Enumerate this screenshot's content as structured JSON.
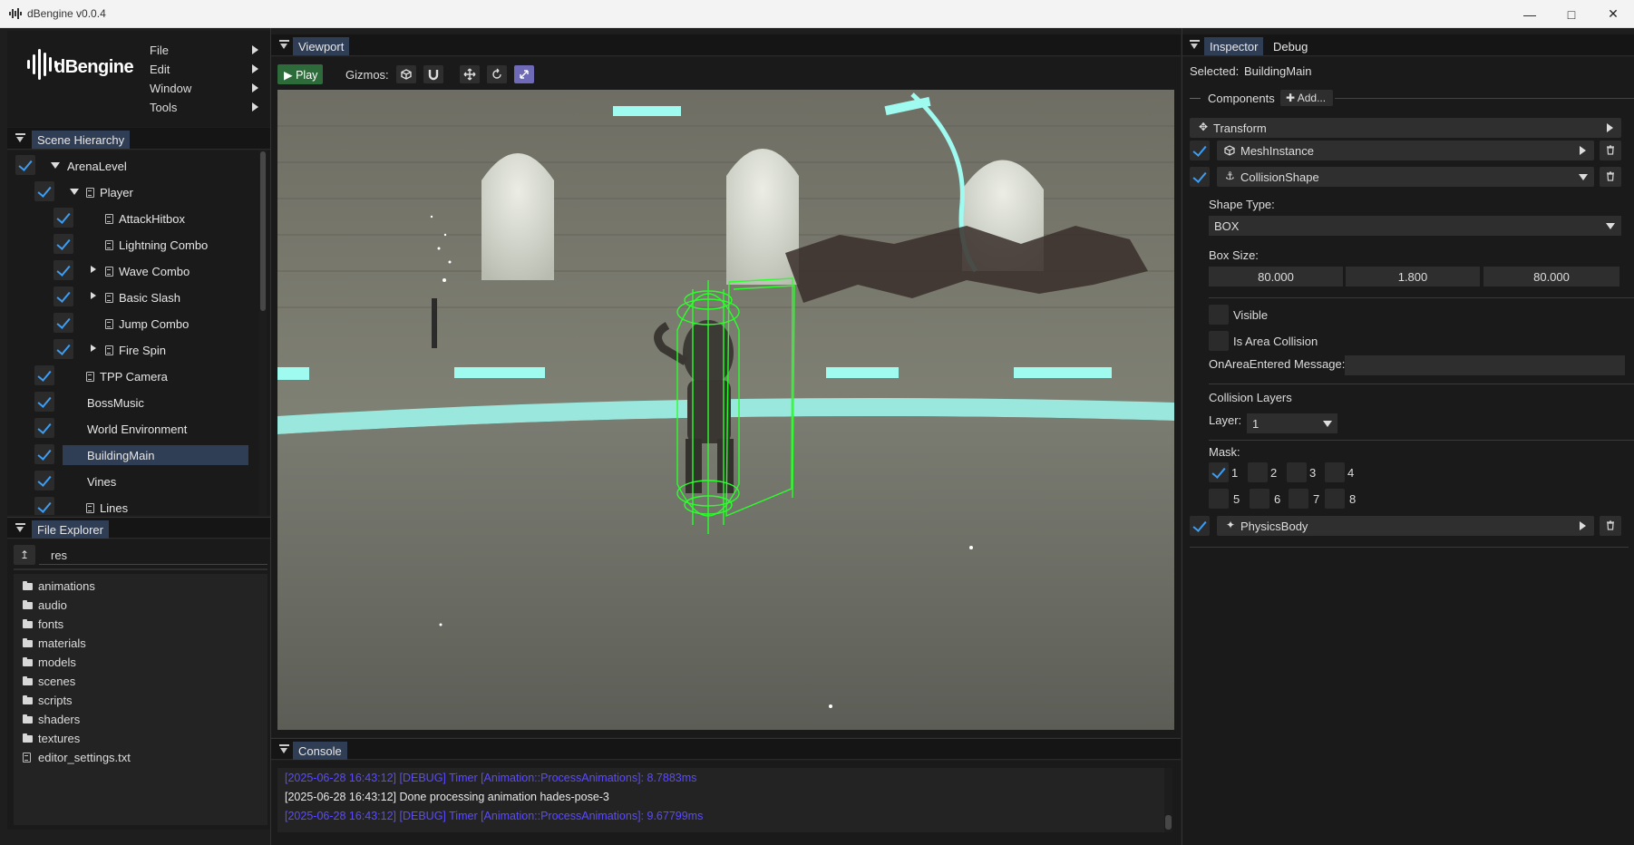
{
  "window": {
    "title": "dBengine v0.0.4"
  },
  "brand": {
    "logo_text": "dBengine"
  },
  "menu": [
    {
      "label": "File"
    },
    {
      "label": "Edit"
    },
    {
      "label": "Window"
    },
    {
      "label": "Tools"
    }
  ],
  "scene_hierarchy": {
    "tab": "Scene Hierarchy",
    "nodes": [
      {
        "label": "ArenaLevel",
        "checked": true,
        "selected": false
      },
      {
        "label": "Player",
        "checked": true
      },
      {
        "label": "AttackHitbox",
        "checked": true
      },
      {
        "label": "Lightning Combo",
        "checked": true
      },
      {
        "label": "Wave Combo",
        "checked": true
      },
      {
        "label": "Basic Slash",
        "checked": true
      },
      {
        "label": "Jump Combo",
        "checked": true
      },
      {
        "label": "Fire Spin",
        "checked": true
      },
      {
        "label": "TPP Camera",
        "checked": true
      },
      {
        "label": "BossMusic",
        "checked": true
      },
      {
        "label": "World Environment",
        "checked": true
      },
      {
        "label": "BuildingMain",
        "checked": true,
        "selected": true
      },
      {
        "label": "Vines",
        "checked": true
      },
      {
        "label": "Lines",
        "checked": true
      }
    ]
  },
  "file_explorer": {
    "tab": "File Explorer",
    "path": "res",
    "items": [
      {
        "label": "animations",
        "type": "folder"
      },
      {
        "label": "audio",
        "type": "folder"
      },
      {
        "label": "fonts",
        "type": "folder"
      },
      {
        "label": "materials",
        "type": "folder"
      },
      {
        "label": "models",
        "type": "folder"
      },
      {
        "label": "scenes",
        "type": "folder"
      },
      {
        "label": "scripts",
        "type": "folder"
      },
      {
        "label": "shaders",
        "type": "folder"
      },
      {
        "label": "textures",
        "type": "folder"
      },
      {
        "label": "editor_settings.txt",
        "type": "file"
      }
    ]
  },
  "viewport": {
    "tab": "Viewport",
    "play_label": "▶ Play",
    "gizmos_label": "Gizmos:"
  },
  "console": {
    "tab": "Console",
    "lines": [
      {
        "text": "[2025-06-28 16:43:12] [DEBUG] Timer [Animation::ProcessAnimations]: 8.7883ms",
        "color": "#5b4bff"
      },
      {
        "text": "[2025-06-28 16:43:12] Done processing animation hades-pose-3",
        "color": "#e8e8e8"
      },
      {
        "text": "[2025-06-28 16:43:12] [DEBUG] Timer [Animation::ProcessAnimations]: 9.67799ms",
        "color": "#5b4bff"
      }
    ]
  },
  "inspector": {
    "tabs": [
      "Inspector",
      "Debug"
    ],
    "selected_label": "Selected:",
    "selected_value": "BuildingMain",
    "components_label": "Components",
    "add_label": "✚ Add...",
    "transform": "Transform",
    "mesh_instance": "MeshInstance",
    "collision_shape": "CollisionShape",
    "shape_type_label": "Shape Type:",
    "shape_type_value": "BOX",
    "box_size_label": "Box Size:",
    "box_size": [
      "80.000",
      "1.800",
      "80.000"
    ],
    "visible_label": "Visible",
    "is_area_label": "Is Area Collision",
    "on_area_label": "OnAreaEntered Message:",
    "on_area_value": "",
    "collision_layers_label": "Collision Layers",
    "layer_label": "Layer:",
    "layer_value": "1",
    "mask_label": "Mask:",
    "mask": [
      {
        "label": "1",
        "checked": true
      },
      {
        "label": "2",
        "checked": false
      },
      {
        "label": "3",
        "checked": false
      },
      {
        "label": "4",
        "checked": false
      },
      {
        "label": "5",
        "checked": false
      },
      {
        "label": "6",
        "checked": false
      },
      {
        "label": "7",
        "checked": false
      },
      {
        "label": "8",
        "checked": false
      }
    ],
    "physics_body": "PhysicsBody"
  },
  "colors": {
    "accent": "#3d9df3",
    "selection": "#2f3d55",
    "wireframe": "#2bff2b",
    "glow": "#9ffaf0"
  }
}
